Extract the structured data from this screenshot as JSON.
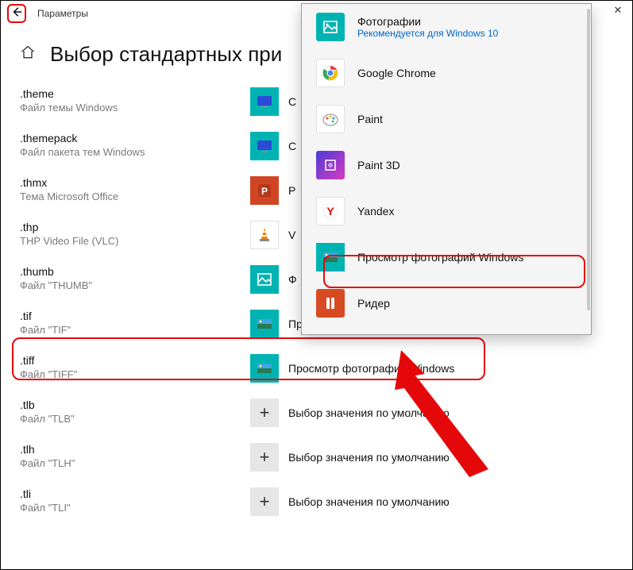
{
  "header": {
    "title": "Параметры"
  },
  "win": {
    "min": "—",
    "max": "▢",
    "close": "✕"
  },
  "page": {
    "title": "Выбор стандартных при"
  },
  "rows": [
    {
      "ext": ".theme",
      "desc": "Файл темы Windows",
      "app": "С",
      "icon": "monitor"
    },
    {
      "ext": ".themepack",
      "desc": "Файл пакета тем Windows",
      "app": "С",
      "icon": "monitor"
    },
    {
      "ext": ".thmx",
      "desc": "Тема Microsoft Office",
      "app": "P",
      "icon": "powerpoint"
    },
    {
      "ext": ".thp",
      "desc": "THP Video File (VLC)",
      "app": "V",
      "icon": "vlc"
    },
    {
      "ext": ".thumb",
      "desc": "Файл \"THUMB\"",
      "app": "Ф",
      "icon": "photo-blank"
    },
    {
      "ext": ".tif",
      "desc": "Файл \"TIF\"",
      "app": "Просмотр фотографий Windows",
      "icon": "photoviewer"
    },
    {
      "ext": ".tiff",
      "desc": "Файл \"TIFF\"",
      "app": "Просмотр фотографий Windows",
      "icon": "photoviewer"
    },
    {
      "ext": ".tlb",
      "desc": "Файл \"TLB\"",
      "app": "Выбор значения по умолчанию",
      "icon": "plus"
    },
    {
      "ext": ".tlh",
      "desc": "Файл \"TLH\"",
      "app": "Выбор значения по умолчанию",
      "icon": "plus"
    },
    {
      "ext": ".tli",
      "desc": "Файл \"TLI\"",
      "app": "Выбор значения по умолчанию",
      "icon": "plus"
    }
  ],
  "popup": {
    "items": [
      {
        "name": "Фотографии",
        "note": "Рекомендуется для Windows 10",
        "icon": "photos"
      },
      {
        "name": "Google Chrome",
        "icon": "chrome"
      },
      {
        "name": "Paint",
        "icon": "paint"
      },
      {
        "name": "Paint 3D",
        "icon": "paint3d"
      },
      {
        "name": "Yandex",
        "icon": "yandex"
      },
      {
        "name": "Просмотр фотографий Windows",
        "icon": "photoviewer"
      },
      {
        "name": "Ридер",
        "icon": "reader"
      }
    ]
  }
}
